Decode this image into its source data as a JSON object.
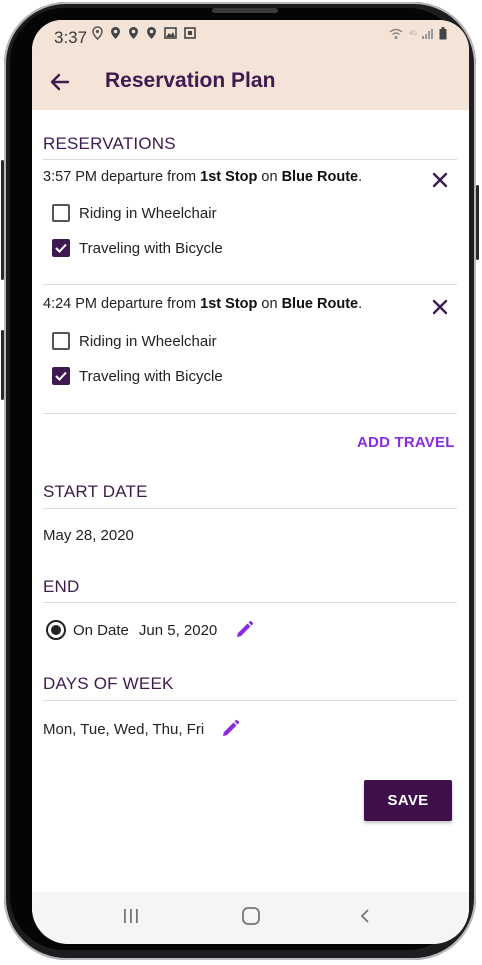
{
  "status_bar": {
    "time": "3:37"
  },
  "app_bar": {
    "title": "Reservation Plan"
  },
  "reservations": {
    "section_title": "RESERVATIONS",
    "items": [
      {
        "time_text": "3:57 PM departure from ",
        "stop": "1st Stop",
        "on_text": " on ",
        "route": "Blue Route",
        "end_text": ".",
        "options": [
          {
            "label": "Riding in Wheelchair",
            "checked": false
          },
          {
            "label": "Traveling with Bicycle",
            "checked": true
          }
        ]
      },
      {
        "time_text": "4:24 PM departure from ",
        "stop": "1st Stop",
        "on_text": " on ",
        "route": "Blue Route",
        "end_text": ".",
        "options": [
          {
            "label": "Riding in Wheelchair",
            "checked": false
          },
          {
            "label": "Traveling with Bicycle",
            "checked": true
          }
        ]
      }
    ],
    "add_label": "ADD TRAVEL"
  },
  "start_date": {
    "section_title": "START DATE",
    "value": "May 28, 2020"
  },
  "end": {
    "section_title": "END",
    "option_label": "On Date",
    "value": "Jun 5, 2020",
    "selected": true
  },
  "days_of_week": {
    "section_title": "DAYS OF WEEK",
    "value": "Mon, Tue, Wed, Thu, Fri"
  },
  "save_label": "SAVE",
  "colors": {
    "primary": "#3e1a4e",
    "accent": "#8a2be2",
    "header_bg": "#f4e3d7"
  },
  "icons": {
    "back": "arrow-left-icon",
    "close": "close-icon",
    "edit": "pencil-icon",
    "nav": [
      "recent-apps-icon",
      "home-icon",
      "back-chevron-icon"
    ]
  }
}
